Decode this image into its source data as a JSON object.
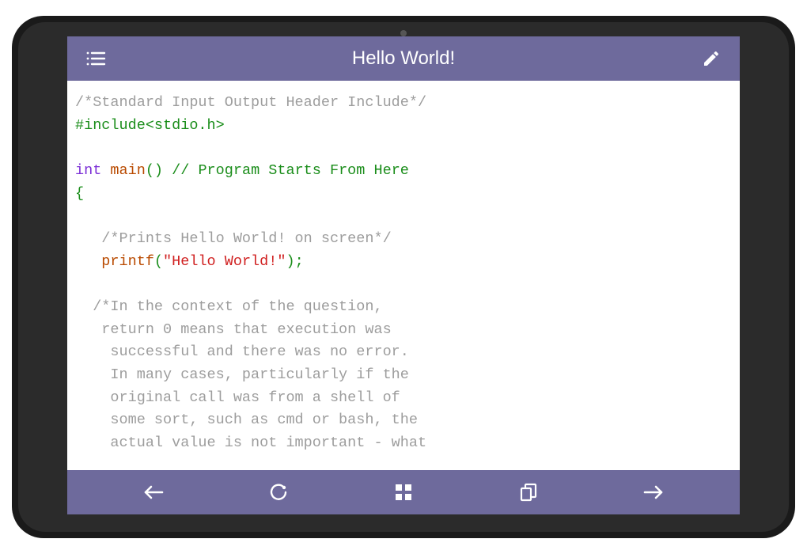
{
  "header": {
    "title": "Hello World!"
  },
  "code": {
    "l1": "/*Standard Input Output Header Include*/",
    "l2": "#include<stdio.h>",
    "l3_kw": "int",
    "l3_fn": " main",
    "l3_paren": "()",
    "l3_comment": " // Program Starts From Here",
    "l4": "{",
    "l6": "   /*Prints Hello World! on screen*/",
    "l7_fn": "   printf",
    "l7_open": "(",
    "l7_str": "\"Hello World!\"",
    "l7_close": ");",
    "l9": "  /*In the context of the question,",
    "l10": "   return 0 means that execution was",
    "l11": "    successful and there was no error.",
    "l12": "    In many cases, particularly if the",
    "l13": "    original call was from a shell of",
    "l14": "    some sort, such as cmd or bash, the",
    "l15": "    actual value is not important - what"
  },
  "colors": {
    "bar": "#6e6a9c",
    "comment": "#9d9d9d",
    "keyword": "#7b2ed6",
    "preproc": "#1a8d1a",
    "func": "#b94a00",
    "string": "#d02020"
  }
}
